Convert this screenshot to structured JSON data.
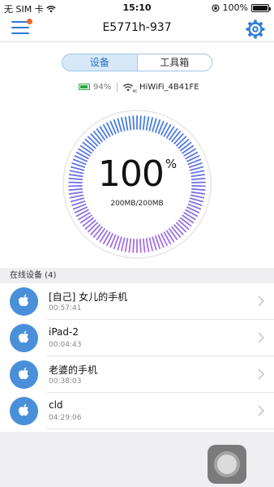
{
  "status_bar": {
    "carrier": "无 SIM 卡",
    "time": "15:10",
    "battery_pct": "100%",
    "battery_level": 1.0
  },
  "nav": {
    "title": "E5771h-937",
    "menu_icon": "hamburger-menu-icon",
    "settings_icon": "gear-icon",
    "accent_color": "#2b7bd6",
    "badge_color": "#f06428"
  },
  "tabs": [
    {
      "label": "设备",
      "active": true
    },
    {
      "label": "工具箱",
      "active": false
    }
  ],
  "device_info": {
    "battery_pct": "94%",
    "battery_level": 0.94,
    "wifi_name": "HiWiFi_4B41FE"
  },
  "gauge": {
    "value": "100",
    "unit": "%",
    "usage": "200MB/200MB",
    "level": 1.0,
    "color_top": "#3a7de0",
    "color_bottom": "#b16ee0"
  },
  "devices": {
    "header": "在线设备 (4)",
    "items": [
      {
        "name": "[自己] 女儿的手机",
        "time": "00:57:41",
        "icon": "apple-icon"
      },
      {
        "name": "iPad-2",
        "time": "00:04:43",
        "icon": "apple-icon"
      },
      {
        "name": "老婆的手机",
        "time": "00:38:03",
        "icon": "apple-icon"
      },
      {
        "name": "cld",
        "time": "04:29:06",
        "icon": "apple-icon"
      }
    ]
  }
}
